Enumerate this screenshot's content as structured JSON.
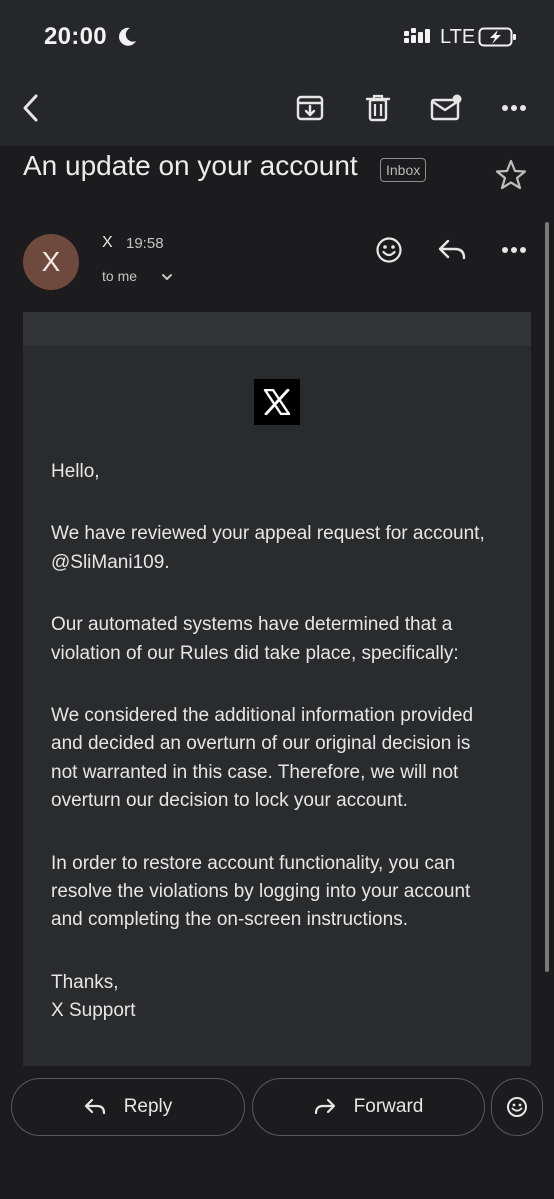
{
  "status_bar": {
    "time": "20:00",
    "network": "LTE",
    "icons": [
      "moon-icon",
      "signal-icon",
      "battery-charging-icon"
    ]
  },
  "toolbar": {
    "icons": [
      "back-arrow-icon",
      "archive-icon",
      "trash-icon",
      "mark-unread-icon",
      "more-vert-icon"
    ]
  },
  "email": {
    "subject": "An update on your account",
    "label": "Inbox",
    "sender": {
      "avatar_letter": "X",
      "name": "X",
      "time": "19:58",
      "recipient": "to me"
    },
    "body": {
      "greeting": "Hello,",
      "paragraphs": [
        "We have reviewed your appeal request for account, @SliMani109.",
        "Our automated systems have determined that a violation of our Rules did take place, specifically:",
        "We considered the additional information provided and decided an overturn of our original decision is not warranted in this case. Therefore, we will not overturn our decision to lock your account.",
        "In order to restore account functionality, you can resolve the violations by logging into your account and completing the on-screen instructions."
      ],
      "signoff": "Thanks,",
      "signature": "X Support"
    }
  },
  "actions": {
    "reply_label": "Reply",
    "forward_label": "Forward"
  },
  "colors": {
    "background": "#1c1c1e",
    "toolbar": "#26272a",
    "card": "#2a2b2d",
    "avatar": "#6e4a3e"
  }
}
